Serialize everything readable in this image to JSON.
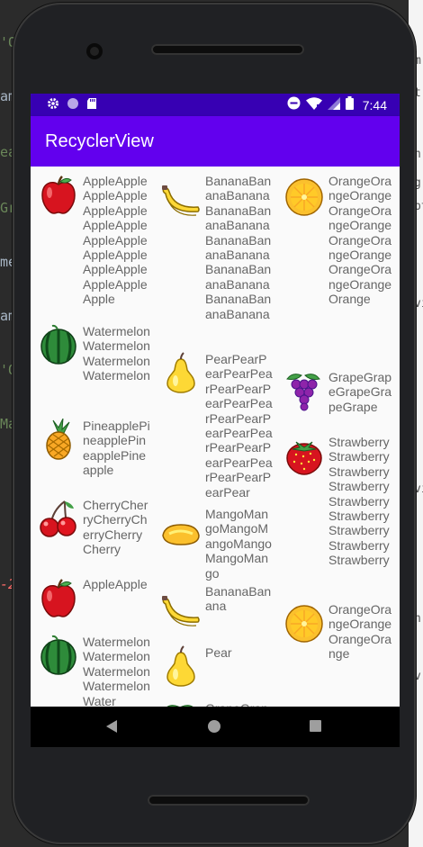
{
  "background": {
    "left_fragments": [
      "'O",
      "am",
      "ea",
      "Gr",
      "me",
      "am",
      "'O",
      "Ma",
      "-2"
    ],
    "right_fragments": [
      "m",
      "t",
      "n",
      "g",
      "pt",
      "vi",
      "vi",
      "n",
      "v"
    ]
  },
  "statusbar": {
    "time": "7:44"
  },
  "appbar": {
    "title": "RecyclerView"
  },
  "colors": {
    "statusbar": "#3700b3",
    "appbar": "#6200ee",
    "list_bg": "#fafafa",
    "label": "#666666"
  },
  "columns": [
    [
      {
        "fruit": "apple",
        "label": "AppleAppleAppleAppleAppleAppleAppleAppleAppleAppleAppleAppleAppleAppleAppleAppleApple"
      },
      {
        "fruit": "watermelon",
        "label": "WatermelonWatermelonWatermelonWatermelon"
      },
      {
        "fruit": "pineapple",
        "label": "PineapplePineapplePineapplePineapple"
      },
      {
        "fruit": "cherry",
        "label": "CherryCherryCherryCherryCherryCherry"
      },
      {
        "fruit": "apple",
        "label": "AppleApple"
      },
      {
        "fruit": "watermelon",
        "label": "WatermelonWatermelonWatermelonWatermelonWater"
      }
    ],
    [
      {
        "fruit": "banana",
        "label": "BananaBananaBananaBananaBananaBananaBananaBananaBananaBananaBananaBananaBananaBananaBanana"
      },
      {
        "fruit": "pear",
        "label": "PearPearPearPearPearPearPearPearPearPearPearPearPearPearPearPearPearPearPearPearPearPearPearPear"
      },
      {
        "fruit": "mango",
        "label": "MangoMangoMangoMangoMangoMangoMango"
      },
      {
        "fruit": "banana",
        "label": "BananaBanana"
      },
      {
        "fruit": "pear",
        "label": "Pear"
      },
      {
        "fruit": "grape",
        "label": "GrapeGrap"
      }
    ],
    [
      {
        "fruit": "orange",
        "label": "OrangeOrangeOrangeOrangeOrangeOrangeOrangeOrangeOrangeOrangeOrangeOrangeOrange"
      },
      {
        "fruit": "grape",
        "label": "GrapeGrapeGrapeGrapeGrape"
      },
      {
        "fruit": "strawberry",
        "label": "StrawberryStrawberryStrawberryStrawberryStrawberryStrawberryStrawberryStrawberryStrawberry"
      },
      {
        "fruit": "orange",
        "label": "OrangeOrangeOrangeOrangeOrange"
      }
    ]
  ]
}
